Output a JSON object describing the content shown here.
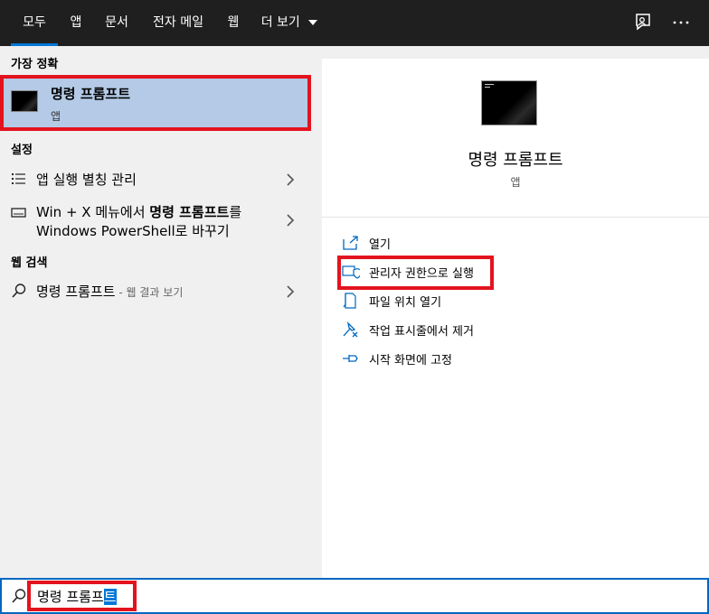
{
  "tabs": [
    {
      "label": "모두",
      "active": true
    },
    {
      "label": "앱"
    },
    {
      "label": "문서"
    },
    {
      "label": "전자 메일"
    },
    {
      "label": "웹"
    },
    {
      "label": "더 보기"
    }
  ],
  "toolbar": {
    "feedback_icon": "feedback-icon",
    "more_icon": "ellipsis-icon"
  },
  "left": {
    "best_match_header": "가장 정확",
    "best_match": {
      "title": "명령 프롬프트",
      "subtitle": "앱"
    },
    "settings_header": "설정",
    "settings": [
      {
        "label": "앱 실행 별칭 관리",
        "icon": "list-icon"
      },
      {
        "line1_pre": "Win + X 메뉴에서 ",
        "line1_bold": "명령 프롬프트",
        "line1_post": "를",
        "line2": "Windows PowerShell로 바꾸기",
        "icon": "monitor-icon"
      }
    ],
    "web_header": "웹 검색",
    "web": {
      "query": "명령 프롬프트",
      "suffix": " - 웹 결과 보기",
      "icon": "search-icon"
    }
  },
  "right": {
    "title": "명령 프롬프트",
    "subtitle": "앱",
    "actions": [
      {
        "label": "열기",
        "icon": "open-icon"
      },
      {
        "label": "관리자 권한으로 실행",
        "icon": "shield-icon"
      },
      {
        "label": "파일 위치 열기",
        "icon": "file-location-icon"
      },
      {
        "label": "작업 표시줄에서 제거",
        "icon": "unpin-icon"
      },
      {
        "label": "시작 화면에 고정",
        "icon": "pin-icon"
      }
    ]
  },
  "search": {
    "typed": "명령 프롬프",
    "selected": "트"
  },
  "colors": {
    "accent": "#0078d7",
    "highlight": "#b4cae6",
    "callout": "#e3131e",
    "topbar": "#1f1f1f"
  }
}
